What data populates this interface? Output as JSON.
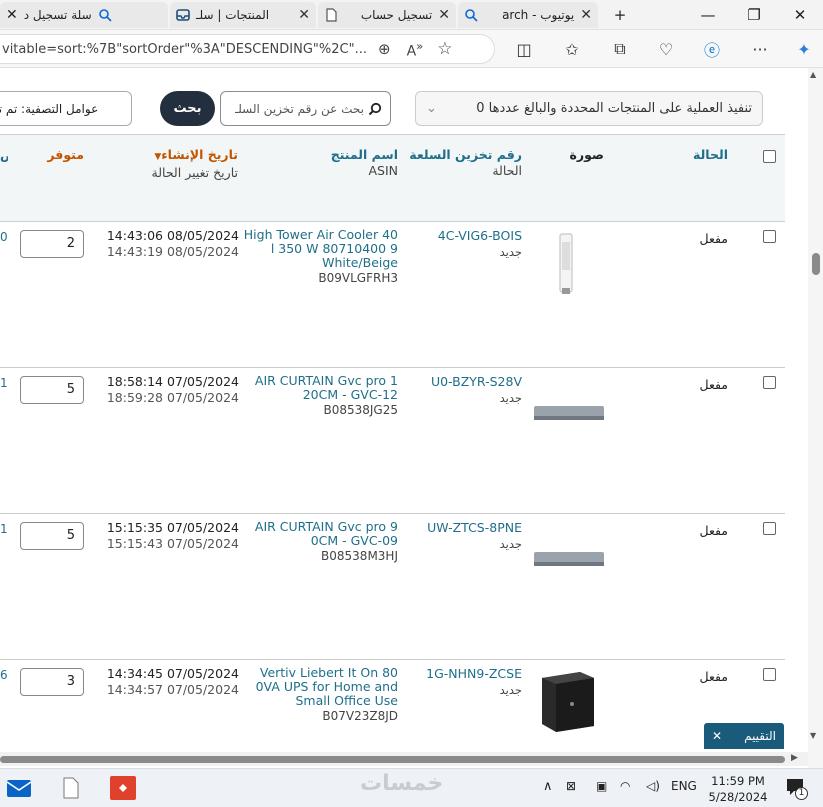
{
  "tabs": [
    {
      "label": "سلة تسجيل د",
      "icon": "search-icon"
    },
    {
      "label": "المنتجات | سلـ",
      "icon": "inbox-icon"
    },
    {
      "label": "تسجيل حساب",
      "icon": "page-icon"
    },
    {
      "label": "يوتيوب - arch",
      "icon": "search-icon"
    }
  ],
  "address": {
    "url": "vitable=sort:%7B\"sortOrder\"%3A\"DESCENDING\"%2C\"..."
  },
  "toolbar": {
    "bulk_action": "تنفيذ العملية على المنتجات المحددة والبالغ عددها 0",
    "search_placeholder": "بحث عن رقم تخزين السلـ",
    "search_button": "بحث",
    "filters": "عوامل التصفية: تم تح"
  },
  "table": {
    "headers": {
      "status": "الحالة",
      "image": "صورة",
      "sku": "رقم تخزين السلعة",
      "sku_sub": "الحالة",
      "name": "اسم المنتج",
      "name_sub": "ASIN",
      "created": "تاريخ الإنشاء",
      "created_sub": "تاريخ تغيير الحالة",
      "available": "متوفر",
      "edge": "ص"
    },
    "rows": [
      {
        "status": "مفعل",
        "sku": "4C-VIG6-BOIS",
        "condition": "جديد",
        "name": "High Tower Air Cooler 40 l 350 W 80710400 9 White/Beige",
        "asin": "B09VLGFRH3",
        "created": "14:43:06 08/05/2024",
        "changed": "14:43:19 08/05/2024",
        "qty": "2",
        "edge": "0",
        "image": "tower-cooler"
      },
      {
        "status": "مفعل",
        "sku": "U0-BZYR-S28V",
        "condition": "جديد",
        "name": "AIR CURTAIN Gvc pro 1 20CM - GVC-12",
        "asin": "B08538JG25",
        "created": "18:58:14 07/05/2024",
        "changed": "18:59:28 07/05/2024",
        "qty": "5",
        "edge": "1",
        "image": "air-curtain"
      },
      {
        "status": "مفعل",
        "sku": "UW-ZTCS-8PNE",
        "condition": "جديد",
        "name": "AIR CURTAIN Gvc pro 9 0CM - GVC-09",
        "asin": "B08538M3HJ",
        "created": "15:15:35 07/05/2024",
        "changed": "15:15:43 07/05/2024",
        "qty": "5",
        "edge": "1",
        "image": "air-curtain"
      },
      {
        "status": "مفعل",
        "sku": "1G-NHN9-ZCSE",
        "condition": "جديد",
        "name": "Vertiv Liebert It On 80 0VA UPS for Home and Small Office Use",
        "asin": "B07V23Z8JD",
        "created": "14:34:45 07/05/2024",
        "changed": "14:34:57 07/05/2024",
        "qty": "3",
        "edge": "6",
        "image": "ups"
      }
    ]
  },
  "rating_widget": {
    "label": "التقييم"
  },
  "taskbar": {
    "watermark": "خمسات",
    "lang": "ENG",
    "time": "11:59 PM",
    "date": "5/28/2024",
    "notif_count": "1"
  },
  "colors": {
    "accent": "#1f6f8b",
    "dark_button": "#232f3e",
    "header_bg": "#f2f6f7"
  }
}
